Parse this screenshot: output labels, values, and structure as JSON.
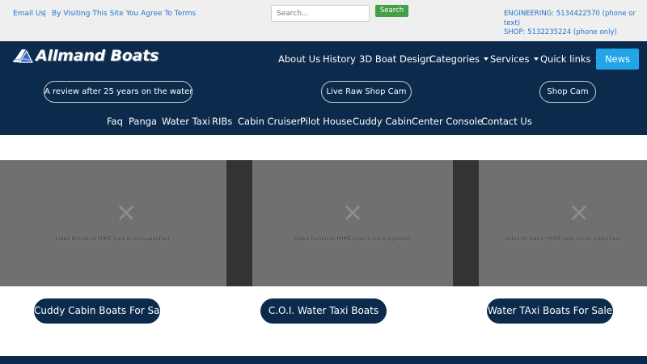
{
  "topbar": {
    "email_link": "Email Us",
    "separator": "|",
    "terms_link": "By Visiting This Site You Agree To Terms",
    "search": {
      "placeholder": "Search...",
      "button_label": "Search"
    },
    "contact": {
      "engineering": "ENGINEERING: 5134422570 (phone or text)",
      "shop": "SHOP: 5132235224 (phone only)"
    }
  },
  "navbar": {
    "brand": "Allmand Boats",
    "menu": {
      "about": "About Us",
      "history": "History",
      "design": "3D Boat Design",
      "categories": "Categories",
      "services": "Services",
      "quick_links": "Quick links",
      "news": "News"
    },
    "pills": {
      "review": "A review after 25 years on the water",
      "live_cam": "Live Raw Shop Cam",
      "shop_cam": "Shop Cam"
    },
    "categories": {
      "faq": "Faq",
      "panga": "Panga",
      "water_taxi": "Water Taxi",
      "ribs": "RIBs",
      "cabin_cruiser": "Cabin Cruiser",
      "pilot_house": "Pilot House",
      "cuddy_cabin": "Cuddy Cabin",
      "center_console": "Center Console",
      "contact": "Contact Us"
    }
  },
  "videos": {
    "message": "Video format or MIME type is not supported."
  },
  "sale_buttons": {
    "cuddy": "Cuddy Cabin Boats For Sale",
    "coi": "C.O.I. Water Taxi Boats",
    "water_taxi": "Water TAxi Boats For Sale"
  },
  "colors": {
    "navy": "#0c2a4b",
    "link_blue": "#1f74c9",
    "search_green": "#43a047",
    "news_blue": "#22a4e6",
    "video_gray": "#707070"
  }
}
